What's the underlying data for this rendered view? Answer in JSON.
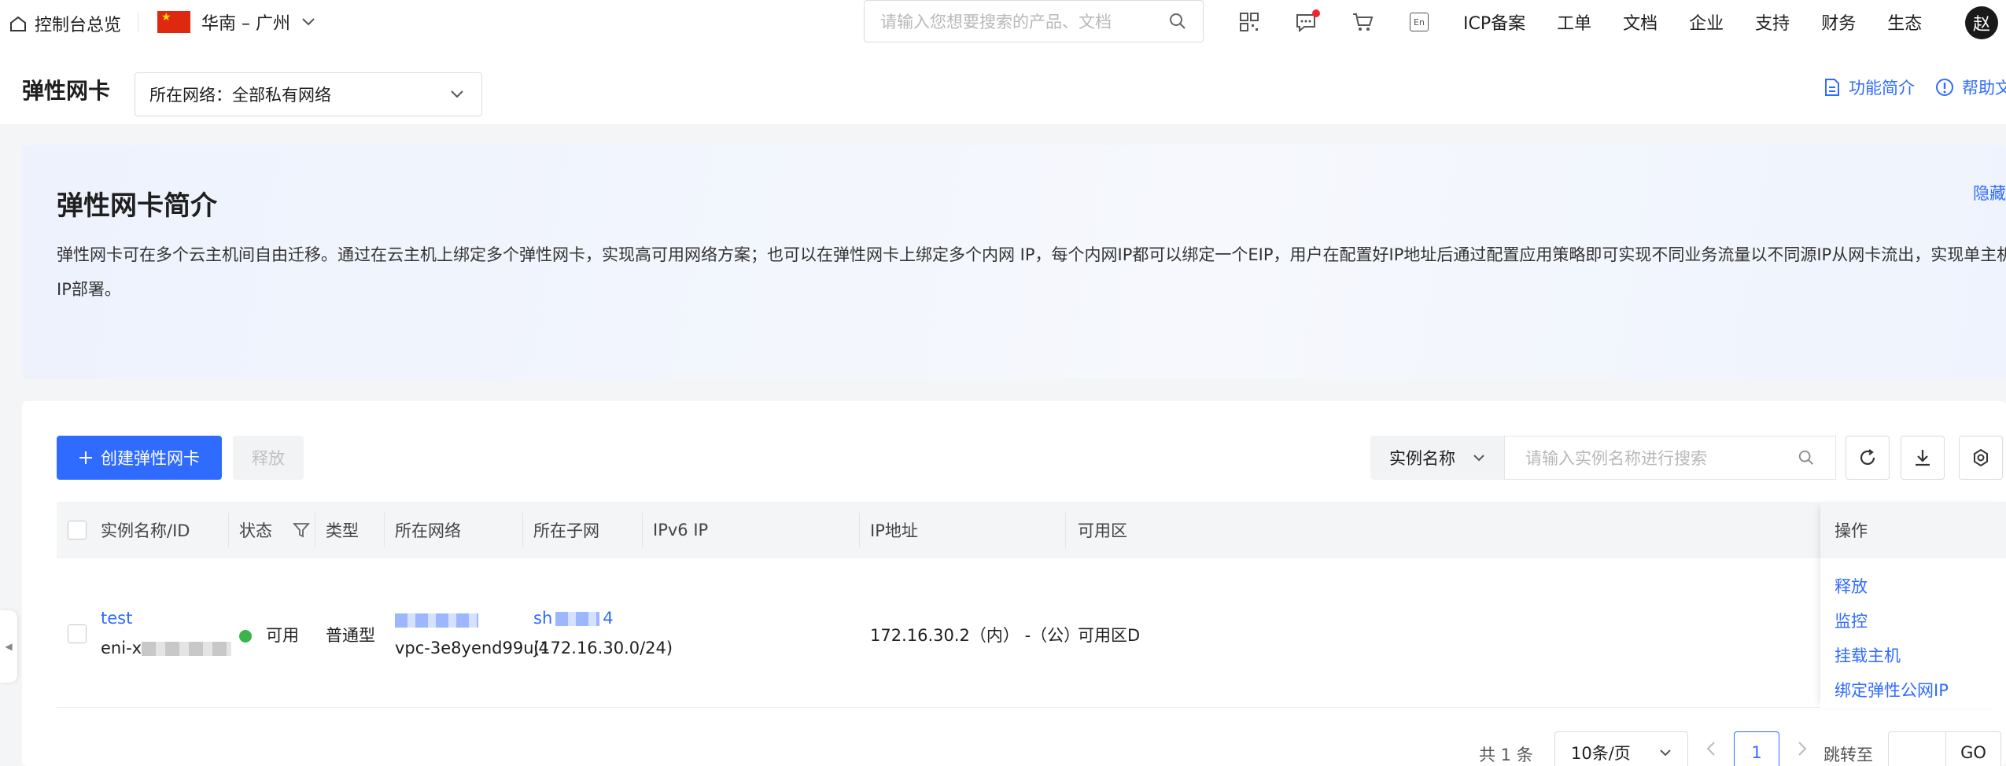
{
  "topbar": {
    "home_label": "控制台总览",
    "region": "华南 – 广州",
    "search_placeholder": "请输入您想要搜索的产品、文档",
    "nav": [
      "ICP备案",
      "工单",
      "文档",
      "企业",
      "支持",
      "财务",
      "生态"
    ],
    "avatar": "赵",
    "lang_icon_text": "En"
  },
  "header": {
    "title": "弹性网卡",
    "network_select": "所在网络：全部私有网络",
    "feature_link": "功能简介",
    "help_link": "帮助文"
  },
  "intro": {
    "title": "弹性网卡简介",
    "hide": "隐藏",
    "text": "弹性网卡可在多个云主机间自由迁移。通过在云主机上绑定多个弹性网卡，实现高可用网络方案；也可以在弹性网卡上绑定多个内网 IP，每个内网IP都可以绑定一个EIP，用户在配置好IP地址后通过配置应用策略即可实现不同业务流量以不同源IP从网卡流出，实现单主机多IP部署。"
  },
  "toolbar": {
    "create": "创建弹性网卡",
    "release": "释放",
    "filter": "实例名称",
    "search_placeholder": "请输入实例名称进行搜索"
  },
  "table": {
    "columns": [
      "实例名称/ID",
      "状态",
      "类型",
      "所在网络",
      "所在子网",
      "IPv6 IP",
      "IP地址",
      "可用区",
      "操作"
    ],
    "row": {
      "name": "test",
      "id_prefix": "eni-x",
      "status": "可用",
      "type": "普通型",
      "vpc_id": "vpc-3e8yend99uj4",
      "subnet_prefix": "sh",
      "subnet_suffix": "4",
      "subnet_cidr": "(172.16.30.0/24)",
      "ip": "172.16.30.2（内） -（公）",
      "zone": "可用区D",
      "actions": [
        "释放",
        "监控",
        "挂载主机",
        "绑定弹性公网IP"
      ]
    }
  },
  "pagination": {
    "total": "共 1 条",
    "page_size": "10条/页",
    "current": "1",
    "jump": "跳转至",
    "go": "GO"
  },
  "colors": {
    "primary": "#2f6bff",
    "status_ok": "#3bb44a"
  }
}
